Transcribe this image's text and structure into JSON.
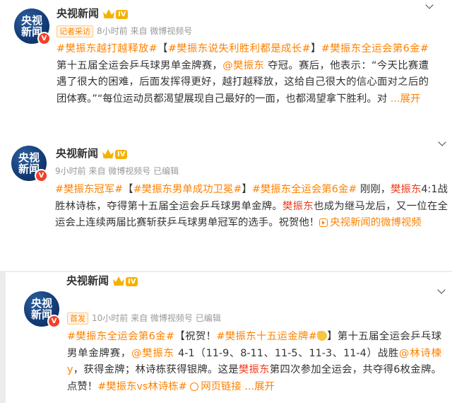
{
  "accent_color": "#ff8200",
  "posts": [
    {
      "account": "央视新闻",
      "avatar_top": "央视",
      "avatar_bottom": "新闻",
      "badge": "V",
      "level": "IV",
      "tag": "记者采访",
      "time": "8小时前",
      "source": "来自 微博视频号",
      "body": [
        [
          "t",
          "#樊振东越打越释放#"
        ],
        [
          "p",
          "【"
        ],
        [
          "t",
          "#樊振东说失利胜利都是成长#"
        ],
        [
          "p",
          "】"
        ],
        [
          "t",
          "#樊振东全运会第6金#"
        ],
        [
          "p",
          " 第十五届全运会乒乓球男单金牌赛，"
        ],
        [
          "t",
          "@樊振东"
        ],
        [
          "p",
          " 夺冠。赛后，他表示：“今天比赛遭遇了很大的困难，后面发挥得更好，越打越释放，这给自己很大的信心面对之后的团体赛。”“每位运动员都渴望展现自己最好的一面，也都渴望拿下胜利。对 "
        ],
        [
          "t",
          "...展开"
        ]
      ]
    },
    {
      "account": "央视新闻",
      "avatar_top": "央视",
      "avatar_bottom": "新闻",
      "badge": "V",
      "level": "IV",
      "time": "9小时前",
      "source": "来自 微博视频号",
      "edited": "已编辑",
      "body": [
        [
          "t",
          "#樊振东冠军#"
        ],
        [
          "p",
          "【"
        ],
        [
          "t",
          "#樊振东男单成功卫冕#"
        ],
        [
          "p",
          "】"
        ],
        [
          "t",
          "#樊振东全运会第6金#"
        ],
        [
          "p",
          " 刚刚，"
        ],
        [
          "r",
          "樊振东"
        ],
        [
          "p",
          "4:1战胜林诗栋，夺得第十五届全运会乒乓球男单金牌。"
        ],
        [
          "r",
          "樊振东"
        ],
        [
          "p",
          "也成为继马龙后，又一位在全运会上连续两届比赛斩获乒乓球男单冠军的选手。祝贺他！"
        ],
        [
          "v",
          "央视新闻的微博视频"
        ]
      ]
    },
    {
      "account": "央视新闻",
      "avatar_top": "央视",
      "avatar_bottom": "新闻",
      "badge": "V",
      "level": "IV",
      "tag": "首发",
      "time": "10小时前",
      "source": "来自 微博视频号",
      "edited": "已编辑",
      "body": [
        [
          "t",
          "#樊振东全运会第6金#"
        ],
        [
          "p",
          "【祝贺！"
        ],
        [
          "t",
          "#樊振东十五运金牌#"
        ],
        [
          "h",
          ""
        ],
        [
          "p",
          "】第十五届全运会乒乓球男单金牌赛，"
        ],
        [
          "t",
          "@樊振东"
        ],
        [
          "p",
          " 4-1（11-9、8-11、11-5、11-3、11-4）战胜"
        ],
        [
          "t",
          "@林诗楝y"
        ],
        [
          "p",
          "，获得金牌；林诗栋获得银牌。这是"
        ],
        [
          "r",
          "樊振东"
        ],
        [
          "p",
          "第四次参加全运会，共夺得6枚金牌。点赞！"
        ],
        [
          "t",
          "#樊振东vs林诗栋#"
        ],
        [
          "p",
          " "
        ],
        [
          "l",
          "网页链接"
        ],
        [
          "p",
          " "
        ],
        [
          "t",
          "...展开"
        ]
      ]
    }
  ]
}
